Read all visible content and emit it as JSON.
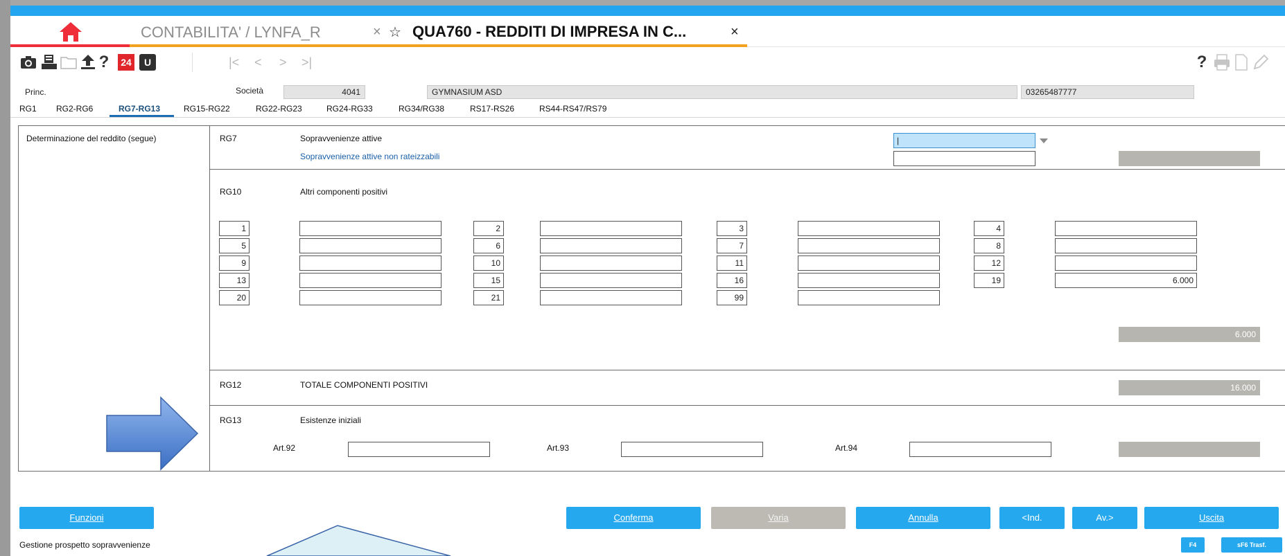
{
  "tabs": {
    "home_icon": "home-icon",
    "contabilita": "CONTABILITA' / LYNFA_R",
    "qua760": "QUA760 - REDDITI DI IMPRESA IN C...",
    "close": "×",
    "star": "☆"
  },
  "toolbar": {
    "icons": [
      "camera-icon",
      "printer-icon",
      "folder-icon",
      "upload-icon",
      "help-icon",
      "calendar-24-icon",
      "u-icon"
    ],
    "help_text": "?",
    "calendar_text": "24",
    "u_text": "U",
    "nav": [
      "|<",
      "<",
      ">",
      ">|"
    ],
    "right_help": "?",
    "right_icons": [
      "pdf-icon",
      "document-icon",
      "edit-icon"
    ]
  },
  "header": {
    "princ_label": "Princ.",
    "societa_label": "Società",
    "societa_code": "4041",
    "societa_name": "GYMNASIUM ASD",
    "tax_code": "03265487777"
  },
  "subtabs": [
    "RG1",
    "RG2-RG6",
    "RG7-RG13",
    "RG15-RG22",
    "RG22-RG23",
    "RG24-RG33",
    "RG34/RG38",
    "RS17-RS26",
    "RS44-RS47/RS79"
  ],
  "active_subtab": "RG7-RG13",
  "section_title": "Determinazione del reddito (segue)",
  "rg7": {
    "code": "RG7",
    "label": "Sopravvenienze attive",
    "sub_label": "Sopravvenienze attive non rateizzabili",
    "input_value": "|"
  },
  "rg10": {
    "code": "RG10",
    "label": "Altri componenti positivi",
    "grid": [
      [
        {
          "code": "1",
          "value": ""
        },
        {
          "code": "2",
          "value": ""
        },
        {
          "code": "3",
          "value": ""
        },
        {
          "code": "4",
          "value": ""
        }
      ],
      [
        {
          "code": "5",
          "value": ""
        },
        {
          "code": "6",
          "value": ""
        },
        {
          "code": "7",
          "value": ""
        },
        {
          "code": "8",
          "value": ""
        }
      ],
      [
        {
          "code": "9",
          "value": ""
        },
        {
          "code": "10",
          "value": ""
        },
        {
          "code": "11",
          "value": ""
        },
        {
          "code": "12",
          "value": ""
        }
      ],
      [
        {
          "code": "13",
          "value": ""
        },
        {
          "code": "15",
          "value": ""
        },
        {
          "code": "16",
          "value": ""
        },
        {
          "code": "19",
          "value": "6.000"
        }
      ],
      [
        {
          "code": "20",
          "value": ""
        },
        {
          "code": "21",
          "value": ""
        },
        {
          "code": "99",
          "value": ""
        }
      ]
    ],
    "total": "6.000"
  },
  "rg12": {
    "code": "RG12",
    "label": "TOTALE COMPONENTI POSITIVI",
    "total": "16.000"
  },
  "rg13": {
    "code": "RG13",
    "label": "Esistenze iniziali",
    "art92": "Art.92",
    "art93": "Art.93",
    "art94": "Art.94"
  },
  "buttons": {
    "funzioni": "Funzioni",
    "conferma": "Conferma",
    "varia": "Varia",
    "annulla": "Annulla",
    "ind": "<Ind.",
    "av": "Av.>",
    "uscita": "Uscita",
    "f4": "F4",
    "sf6": "sF6 Trasf."
  },
  "status_text": "Gestione prospetto sopravvenienze",
  "colors": {
    "accent_blue": "#24a5ef",
    "home_underline": "#ef2e3a",
    "tab_underline": "#f2a21f",
    "total_bg": "#b7b5b0"
  }
}
